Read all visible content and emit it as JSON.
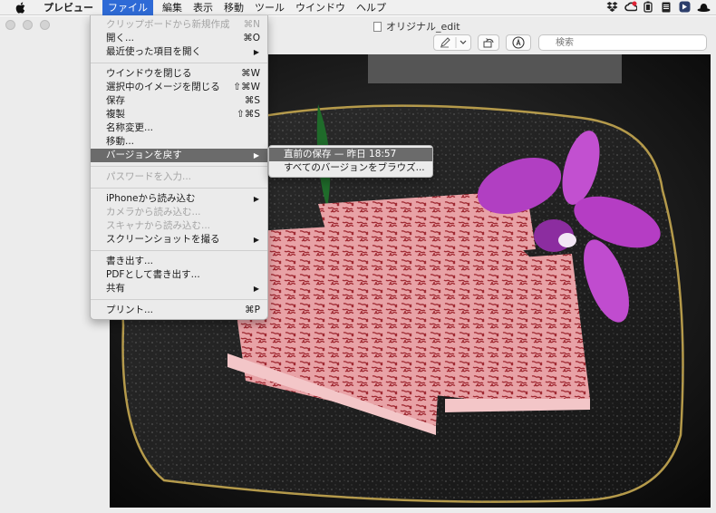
{
  "menubar": {
    "apple_icon": "apple-logo-icon",
    "app_name": "プレビュー",
    "items": [
      "ファイル",
      "編集",
      "表示",
      "移動",
      "ツール",
      "ウインドウ",
      "ヘルプ"
    ],
    "status_icons": [
      "dropbox-icon",
      "creative-cloud-icon",
      "battery-icon",
      "clipboard-icon",
      "app-icon",
      "hat-icon"
    ]
  },
  "window": {
    "title": "オリジナル_edit",
    "search_placeholder": "検索"
  },
  "file_menu": {
    "items": [
      {
        "label": "クリップボードから新規作成",
        "shortcut": "⌘N",
        "disabled": true
      },
      {
        "label": "開く...",
        "shortcut": "⌘O"
      },
      {
        "label": "最近使った項目を開く",
        "submenu": true
      },
      {
        "separator": true
      },
      {
        "label": "ウインドウを閉じる",
        "shortcut": "⌘W"
      },
      {
        "label": "選択中のイメージを閉じる",
        "shortcut": "⇧⌘W"
      },
      {
        "label": "保存",
        "shortcut": "⌘S"
      },
      {
        "label": "複製",
        "shortcut": "⇧⌘S"
      },
      {
        "label": "名称変更..."
      },
      {
        "label": "移動..."
      },
      {
        "label": "バージョンを戻す",
        "submenu": true,
        "highlighted": true
      },
      {
        "separator": true
      },
      {
        "label": "パスワードを入力...",
        "disabled": true
      },
      {
        "separator": true
      },
      {
        "label": "iPhoneから読み込む",
        "submenu": true
      },
      {
        "label": "カメラから読み込む...",
        "disabled": true
      },
      {
        "label": "スキャナから読み込む...",
        "disabled": true
      },
      {
        "label": "スクリーンショットを撮る",
        "submenu": true
      },
      {
        "separator": true
      },
      {
        "label": "書き出す..."
      },
      {
        "label": "PDFとして書き出す..."
      },
      {
        "label": "共有",
        "submenu": true
      },
      {
        "separator": true
      },
      {
        "label": "プリント...",
        "shortcut": "⌘P"
      }
    ]
  },
  "revert_submenu": {
    "items": [
      {
        "label": "直前の保存 — 昨日 18:57",
        "highlighted": true
      },
      {
        "label": "すべてのバージョンをブラウズ..."
      }
    ]
  }
}
